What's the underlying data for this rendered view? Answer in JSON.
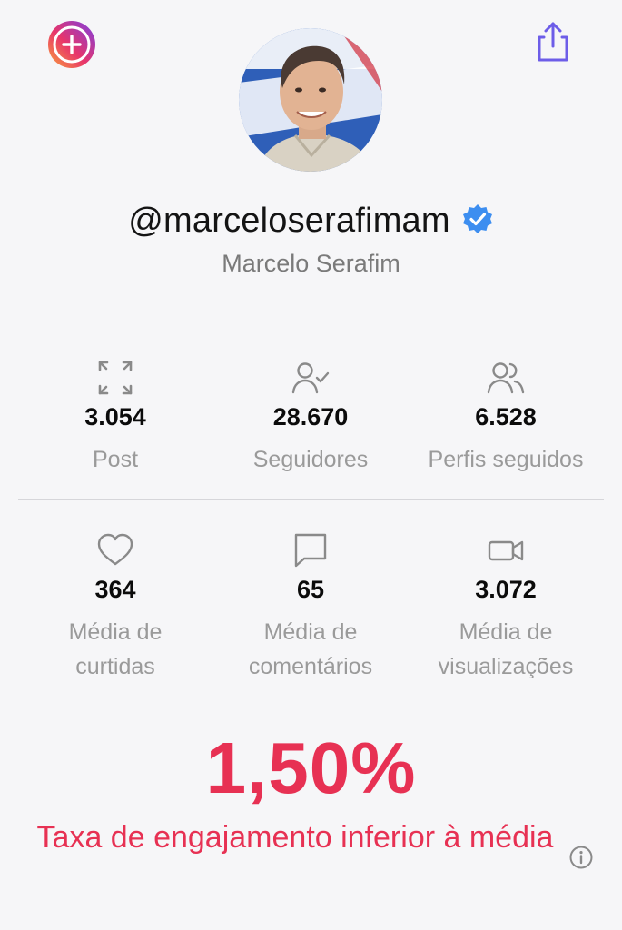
{
  "profile": {
    "handle": "@marceloserafimam",
    "full_name": "Marcelo Serafim",
    "verified": true
  },
  "stats_row1": [
    {
      "icon": "frame-corners-icon",
      "value": "3.054",
      "label": "Post"
    },
    {
      "icon": "user-check-icon",
      "value": "28.670",
      "label": "Seguidores"
    },
    {
      "icon": "users-icon",
      "value": "6.528",
      "label": "Perfis seguidos"
    }
  ],
  "stats_row2": [
    {
      "icon": "heart-icon",
      "value": "364",
      "label_line1": "Média de",
      "label_line2": "curtidas"
    },
    {
      "icon": "comment-icon",
      "value": "65",
      "label_line1": "Média de",
      "label_line2": "comentários"
    },
    {
      "icon": "video-icon",
      "value": "3.072",
      "label_line1": "Média de",
      "label_line2": "visualizações"
    }
  ],
  "engagement": {
    "rate": "1,50%",
    "caption": "Taxa de engajamento inferior à média"
  },
  "colors": {
    "accent": "#e73153",
    "verified": "#3d8ef0",
    "share_icon": "#6d5de8",
    "muted_text": "#9a9a9a"
  }
}
